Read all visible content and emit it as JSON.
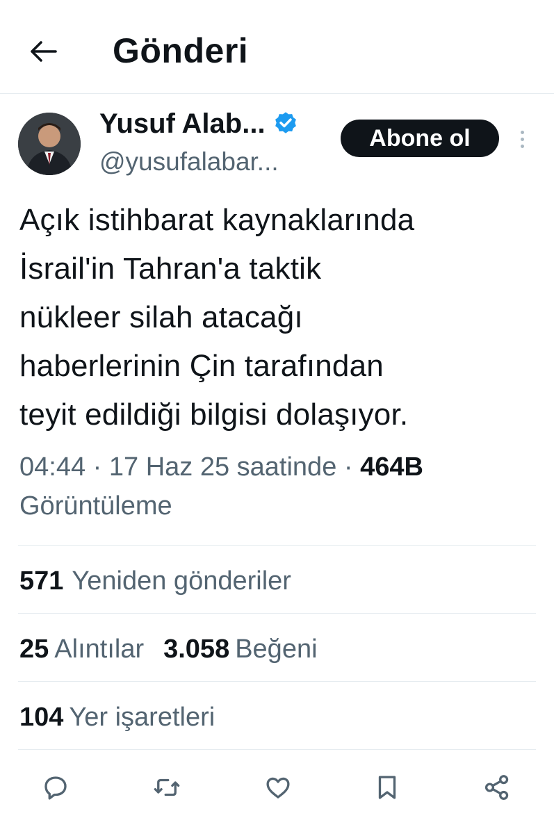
{
  "header": {
    "title": "Gönderi"
  },
  "author": {
    "display_name": "Yusuf Alab...",
    "handle": "@yusufalabar...",
    "verified_color": "#1d9bf0"
  },
  "follow_button": {
    "label": "Abone ol"
  },
  "tweet": {
    "lines": [
      "Açık istihbarat kaynaklarında",
      "İsrail'in Tahran'a taktik",
      "nükleer silah atacağı",
      "haberlerinin Çin tarafından",
      "teyit edildiği bilgisi dolaşıyor."
    ]
  },
  "meta": {
    "time": "04:44",
    "date": "17 Haz 25 saatinde",
    "views_count": "464B",
    "views_label": "Görüntüleme"
  },
  "stats": {
    "reposts": {
      "count": "571",
      "label": "Yeniden gönderiler"
    },
    "quotes": {
      "count": "25",
      "label": "Alıntılar"
    },
    "likes": {
      "count": "3.058",
      "label": "Beğeni"
    },
    "bookmarks": {
      "count": "104",
      "label": "Yer işaretleri"
    }
  },
  "actions": {
    "icons": [
      "reply-icon",
      "retweet-icon",
      "like-icon",
      "bookmark-icon",
      "share-icon"
    ]
  },
  "colors": {
    "text_primary": "#0f1419",
    "text_secondary": "#536471",
    "divider": "#e6ecf0",
    "button_bg": "#0f1419"
  }
}
